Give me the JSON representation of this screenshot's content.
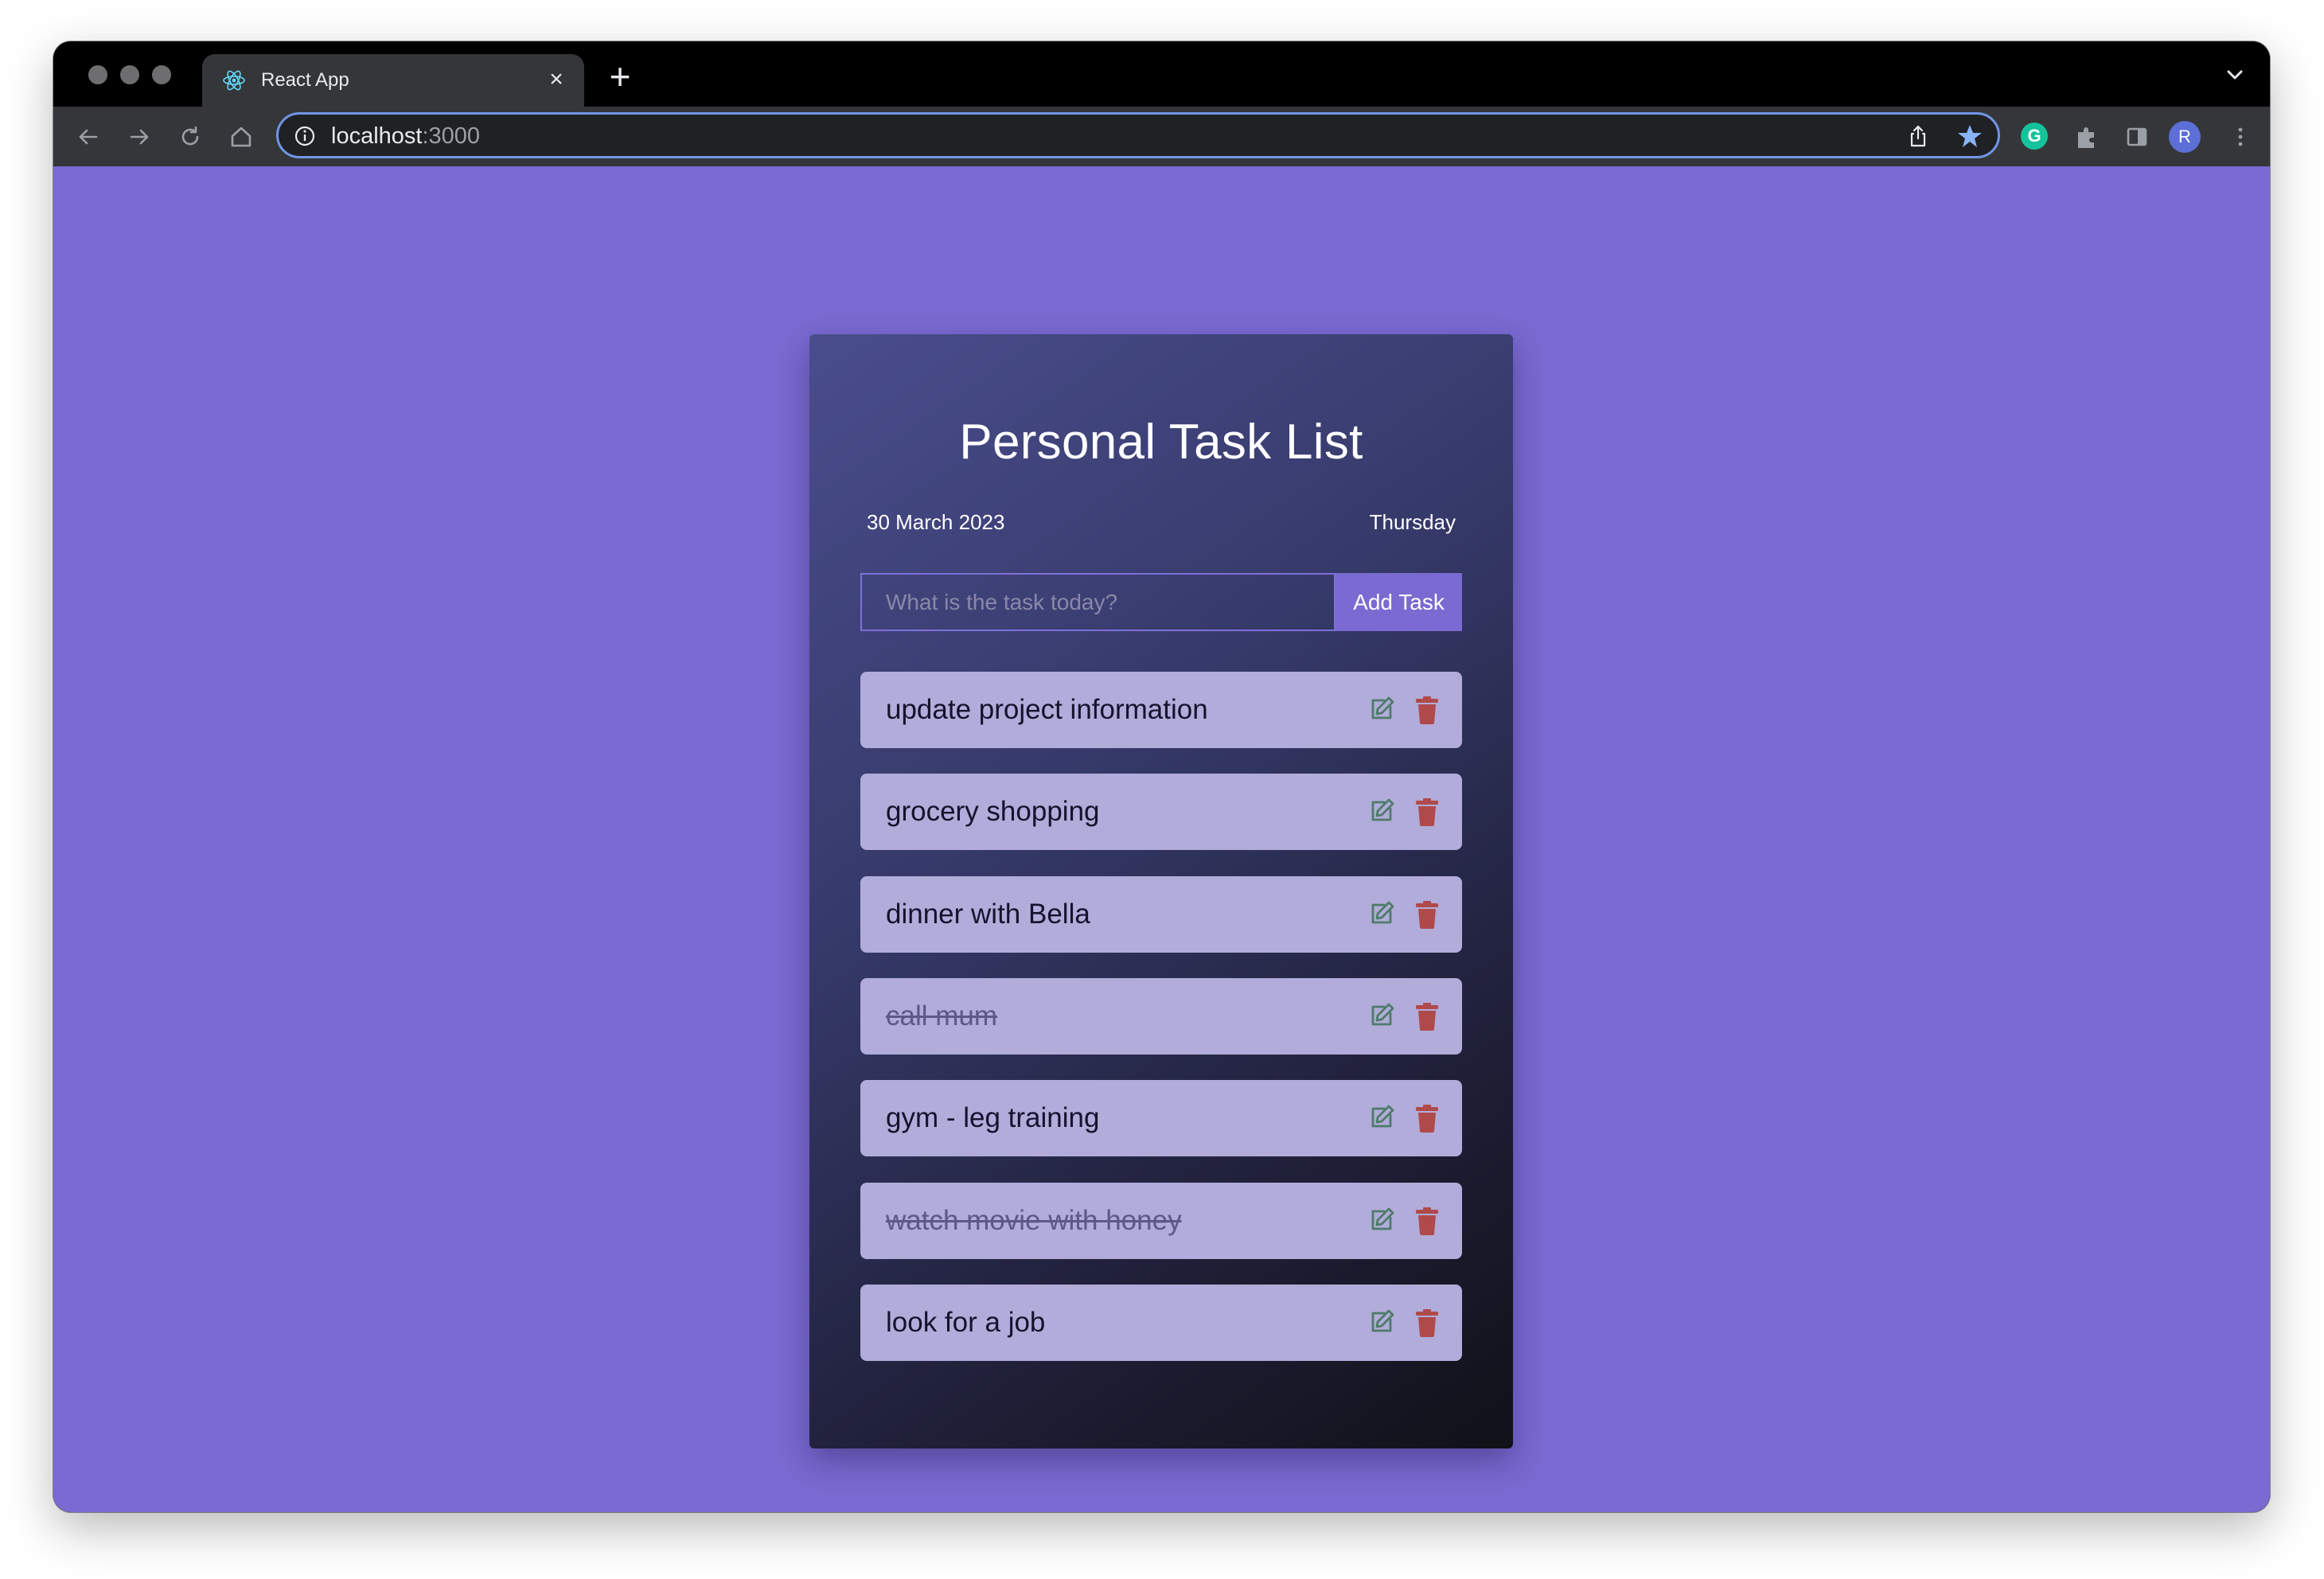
{
  "browser": {
    "tab_title": "React App",
    "tab_close": "×",
    "new_tab": "+",
    "url_host": "localhost",
    "url_port": ":3000",
    "profile_initial": "R",
    "extension_initial": "G"
  },
  "app": {
    "title": "Personal Task List",
    "date": "30 March 2023",
    "day": "Thursday",
    "input_placeholder": "What is the task today?",
    "input_value": "",
    "add_button": "Add Task",
    "tasks": [
      {
        "text": "update project information",
        "completed": false
      },
      {
        "text": "grocery shopping",
        "completed": false
      },
      {
        "text": "dinner with Bella",
        "completed": false
      },
      {
        "text": "call mum",
        "completed": true
      },
      {
        "text": "gym - leg training",
        "completed": false
      },
      {
        "text": "watch movie with honey",
        "completed": true
      },
      {
        "text": "look for a job",
        "completed": false
      }
    ]
  },
  "colors": {
    "page_background": "#7a6ad1",
    "accent": "#7a6ad1",
    "task_background": "#b1acd9",
    "edit_icon": "#4e7b6a",
    "delete_icon": "#b04a4a"
  },
  "icons": [
    "react-icon",
    "close-icon",
    "plus-icon",
    "chevron-down-icon",
    "back-icon",
    "forward-icon",
    "reload-icon",
    "home-icon",
    "info-icon",
    "share-icon",
    "star-icon",
    "grammarly-icon",
    "extensions-icon",
    "side-panel-icon",
    "more-icon",
    "edit-icon",
    "trash-icon"
  ]
}
